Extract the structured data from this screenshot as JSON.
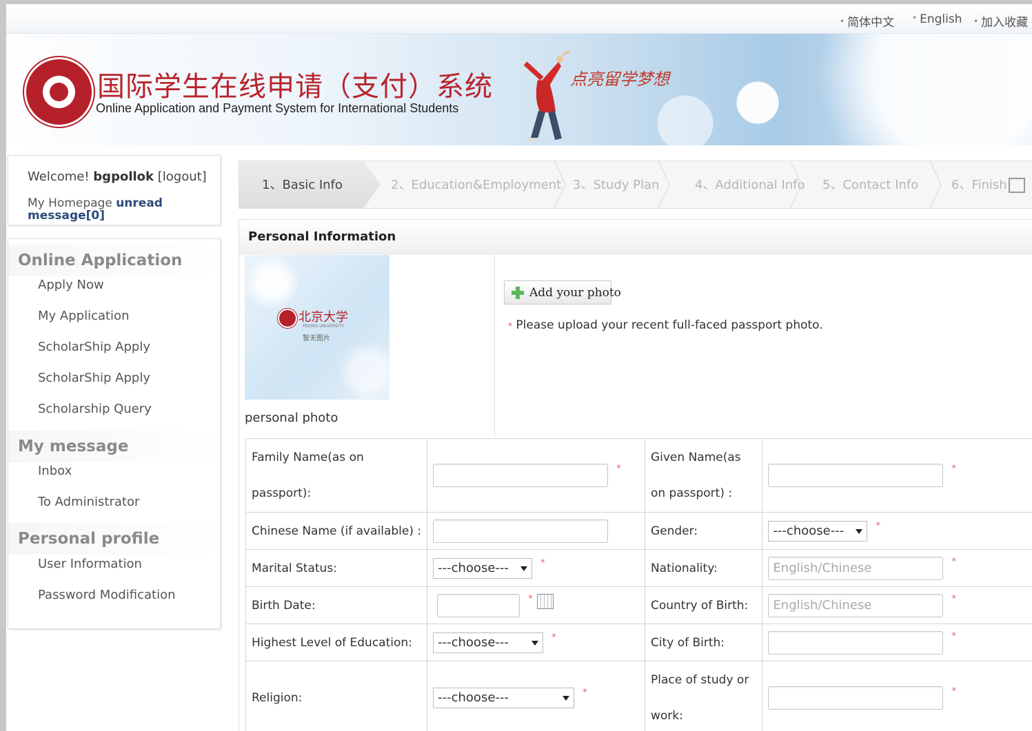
{
  "topbar": {
    "links": [
      "简体中文",
      "English",
      "加入收藏"
    ]
  },
  "banner": {
    "title_cn": "国际学生在线申请（支付）系统",
    "title_en": "Online Application and Payment  System for International Students",
    "slogan": "点亮留学梦想"
  },
  "welcome": {
    "prefix": "Welcome!",
    "username": "bgpollok",
    "logout": "[logout]",
    "homepage": "My Homepage",
    "unread": "unread message[0]"
  },
  "menu": {
    "online_application": {
      "title": "Online Application",
      "items": [
        "Apply Now",
        "My Application",
        "ScholarShip Apply",
        "ScholarShip Apply",
        "Scholarship Query"
      ]
    },
    "my_message": {
      "title": "My message",
      "items": [
        "Inbox",
        "To Administrator"
      ]
    },
    "personal_profile": {
      "title": "Personal profile",
      "items": [
        "User Information",
        "Password Modification"
      ]
    }
  },
  "tabs": [
    {
      "label": "1、Basic Info",
      "active": true
    },
    {
      "label": "2、Education&Employment",
      "active": false
    },
    {
      "label": "3、Study Plan",
      "active": false
    },
    {
      "label": "4、Additional Info",
      "active": false
    },
    {
      "label": "5、Contact Info",
      "active": false
    },
    {
      "label": "6、Finish",
      "active": false
    }
  ],
  "panel": {
    "header": "Personal Information",
    "photo_caption": "personal photo",
    "photo_placeholder_univ": "北京大学",
    "photo_placeholder_univ_en": "PEKING UNIVERSITY",
    "photo_placeholder_text": "暂无图片",
    "add_photo": "Add your photo",
    "photo_note": "Please upload your recent full-faced passport photo."
  },
  "form": {
    "family_name_label": "Family Name(as on passport):",
    "given_name_label": "Given Name(as on passport) :",
    "chinese_name_label": "Chinese Name (if available) :",
    "gender_label": "Gender:",
    "gender_value": "---choose---",
    "marital_label": "Marital Status:",
    "marital_value": "---choose---",
    "nationality_label": "Nationality:",
    "nationality_placeholder": "English/Chinese",
    "birth_date_label": "Birth Date:",
    "country_birth_label": "Country of Birth:",
    "country_birth_placeholder": "English/Chinese",
    "education_label": "Highest Level of Education:",
    "education_value": "---choose---",
    "city_birth_label": "City of Birth:",
    "religion_label": "Religion:",
    "religion_value": "---choose---",
    "study_place_label": "Place of study or work:",
    "required_mark": "*"
  },
  "colors": {
    "brand_red": "#b8232c",
    "required": "#e06060"
  }
}
